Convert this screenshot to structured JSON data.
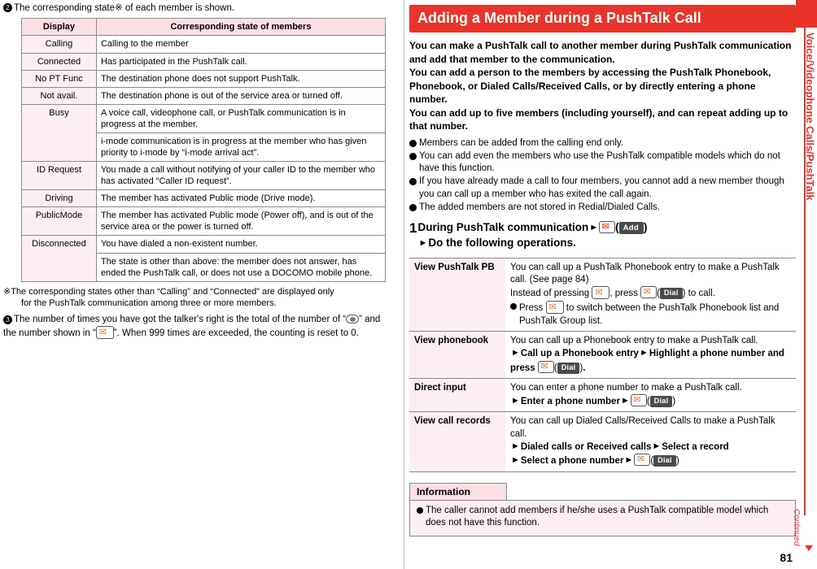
{
  "left": {
    "intro_note": "The corresponding state※ of each member is shown.",
    "table": {
      "headers": [
        "Display",
        "Corresponding state of members"
      ],
      "rows": [
        [
          "Calling",
          "Calling to the member"
        ],
        [
          "Connected",
          "Has participated in the PushTalk call."
        ],
        [
          "No PT Func",
          "The destination phone does not support PushTalk."
        ],
        [
          "Not avail.",
          "The destination phone is out of the service area or turned off."
        ],
        [
          "Busy",
          "A voice call, videophone call, or PushTalk communication is in progress at the member."
        ],
        [
          "",
          "i-mode communication is in progress at the member who has given priority to i-mode by “i-mode arrival act”."
        ],
        [
          "ID Request",
          "You made a call without notifying of your caller ID to the member who has activated “Caller ID request”."
        ],
        [
          "Driving",
          "The member has activated Public mode (Drive mode)."
        ],
        [
          "PublicMode",
          "The member has activated Public mode (Power off), and is out of the service area or the power is turned off."
        ],
        [
          "Disconnected",
          "You have dialed a non-existent number."
        ],
        [
          "",
          "The state is other than above: the member does not answer, has ended the PushTalk call, or does not use a DOCOMO mobile phone."
        ]
      ]
    },
    "footnote_line1": "※The corresponding states other than “Calling” and “Connected” are displayed only",
    "footnote_line2": "for the PushTalk communication among three or more members.",
    "step3_part1": "The number of times you have got the talker's right is the total of the number of “",
    "step3_part2": "” and the number shown in “",
    "step3_part3": "”. When 999 times are exceeded, the counting is reset to 0."
  },
  "right": {
    "title": "Adding a Member during a PushTalk Call",
    "lead": [
      "You can make a PushTalk call to another member during PushTalk communication and add that member to the communication.",
      "You can add a person to the members by accessing the PushTalk Phonebook, Phonebook, or Dialed Calls/Received Calls, or by directly entering a phone number.",
      "You can add up to five members (including yourself), and can repeat adding up to that number."
    ],
    "bullets": [
      "Members can be added from the calling end only.",
      "You can add even the members who use the PushTalk compatible models which do not have this function.",
      "If you have already made a call to four members, you cannot add a new member though you can call up a member who has exited the call again.",
      "The added members are not stored in Redial/Dialed Calls."
    ],
    "step": {
      "number": "1",
      "line1": "During PushTalk communication",
      "key_label": "Add",
      "line2": "Do the following operations."
    },
    "op_table": [
      {
        "key": "View PushTalk PB",
        "lines": [
          "You can call up a PushTalk Phonebook entry to make a PushTalk call. (See page 84)",
          "Instead of pressing |KEY1|, press |MAIL|(|DIAL|) to call."
        ],
        "bullets": [
          "Press |KEY2| to switch between the PushTalk Phonebook list and PushTalk Group list."
        ],
        "dial_label": "Dial"
      },
      {
        "key": "View phonebook",
        "lines": [
          "You can call up a Phonebook entry to make a PushTalk call.",
          "|ARR|Call up a Phonebook entry|ARR|Highlight a phone number and press |MAIL|(|DIAL|)."
        ],
        "bullets": [],
        "dial_label": "Dial"
      },
      {
        "key": "Direct input",
        "lines": [
          "You can enter a phone number to make a PushTalk call.",
          "|ARR|Enter a phone number|ARR||MAIL|(|DIAL|)"
        ],
        "bullets": [],
        "dial_label": "Dial"
      },
      {
        "key": "View call records",
        "lines": [
          "You can call up Dialed Calls/Received Calls to make a PushTalk call.",
          "|ARR|Dialed calls or Received calls|ARR|Select a record",
          "|ARR|Select a phone number|ARR||MAIL|(|DIAL|)"
        ],
        "bullets": [],
        "dial_label": "Dial"
      }
    ],
    "information": {
      "heading": "Information",
      "items": [
        "The caller cannot add members if he/she uses a PushTalk compatible model which does not have this function."
      ]
    }
  },
  "edge": {
    "chapter": "Voice/Videophone Calls/PushTalk",
    "continued": "Continued",
    "page_number": "81",
    "accent": "#e8342a"
  }
}
